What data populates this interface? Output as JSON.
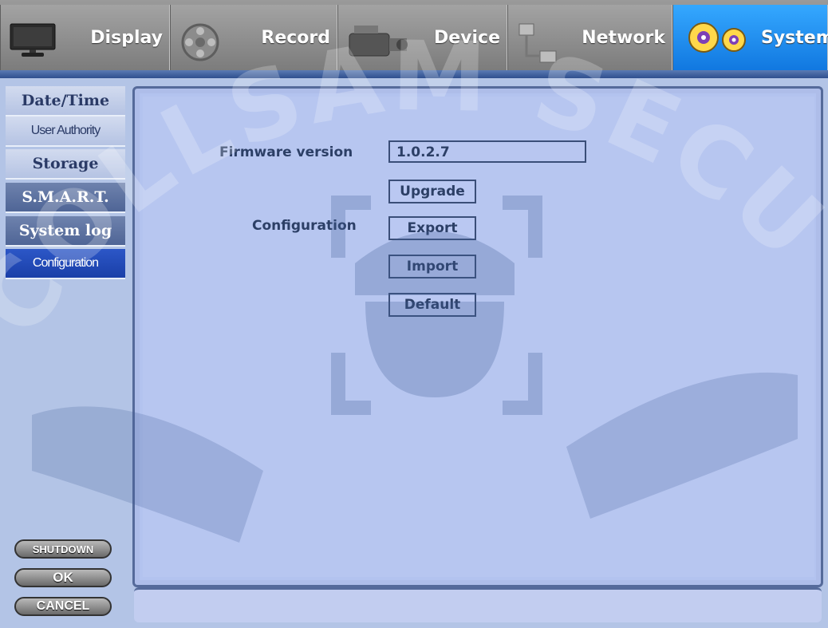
{
  "tabs": [
    {
      "label": "Display",
      "icon": "monitor-icon"
    },
    {
      "label": "Record",
      "icon": "film-reel-icon"
    },
    {
      "label": "Device",
      "icon": "camcorder-icon"
    },
    {
      "label": "Network",
      "icon": "network-icon"
    },
    {
      "label": "System",
      "icon": "gears-icon",
      "active": true
    }
  ],
  "menu": [
    {
      "label": "Date/Time"
    },
    {
      "label": "User Authority"
    },
    {
      "label": "Storage"
    },
    {
      "label": "S.M.A.R.T."
    },
    {
      "label": "System log"
    },
    {
      "label": "Configuration",
      "active": true
    }
  ],
  "main": {
    "firmware_label": "Firmware version",
    "firmware_value": "1.0.2.7",
    "upgrade_label": "Upgrade",
    "configuration_label": "Configuration",
    "export_label": "Export",
    "import_label": "Import",
    "default_label": "Default"
  },
  "actions": {
    "shutdown_label": "SHUTDOWN",
    "ok_label": "OK",
    "cancel_label": "CANCEL"
  },
  "watermark": {
    "text": "COLLSAM SECURITY"
  },
  "colors": {
    "active_tab": "#1f8ff0",
    "active_menu": "#1a3fa8",
    "panel": "#b7c6f0"
  }
}
